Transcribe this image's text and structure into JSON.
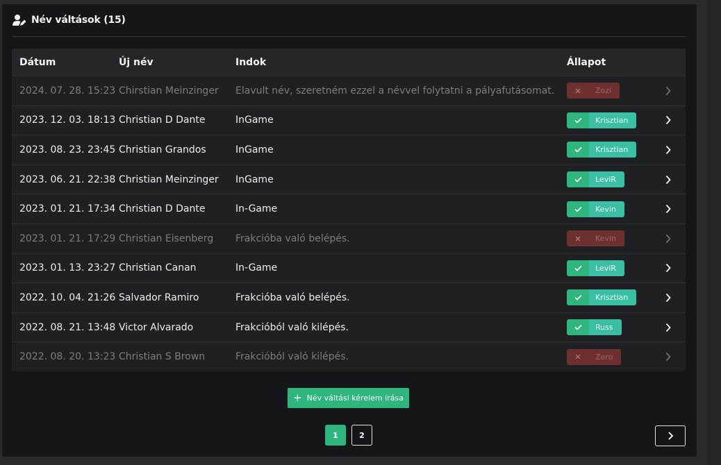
{
  "header": {
    "title": "Név váltások (15)",
    "icon": "user-edit-icon"
  },
  "table": {
    "columns": [
      "Dátum",
      "Új név",
      "Indok",
      "Állapot"
    ],
    "rows": [
      {
        "date": "2024. 07. 28. 15:23",
        "new_name": "Chirstian Meinzinger",
        "reason": "Elavult név, szeretném ezzel a névvel folytatni a pályafutásomat.",
        "status": "rejected",
        "handler": "Zozi"
      },
      {
        "date": "2023. 12. 03. 18:13",
        "new_name": "Christian D Dante",
        "reason": "InGame",
        "status": "approved",
        "handler": "Krisztian"
      },
      {
        "date": "2023. 08. 23. 23:45",
        "new_name": "Christian Grandos",
        "reason": "InGame",
        "status": "approved",
        "handler": "Krisztian"
      },
      {
        "date": "2023. 06. 21. 22:38",
        "new_name": "Christian Meinzinger",
        "reason": "InGame",
        "status": "approved",
        "handler": "LeviR"
      },
      {
        "date": "2023. 01. 21. 17:34",
        "new_name": "Christian D Dante",
        "reason": "In-Game",
        "status": "approved",
        "handler": "Kevin"
      },
      {
        "date": "2023. 01. 21. 17:29",
        "new_name": "Christian Eisenberg",
        "reason": "Frakcióba való belépés.",
        "status": "rejected",
        "handler": "Kevin"
      },
      {
        "date": "2023. 01. 13. 23:27",
        "new_name": "Christian Canan",
        "reason": "In-Game",
        "status": "approved",
        "handler": "LeviR"
      },
      {
        "date": "2022. 10. 04. 21:26",
        "new_name": "Salvador Ramiro",
        "reason": "Frakcióba való belépés.",
        "status": "approved",
        "handler": "Krisztian"
      },
      {
        "date": "2022. 08. 21. 13:48",
        "new_name": "Victor Alvarado",
        "reason": "Frakcióból való kilépés.",
        "status": "approved",
        "handler": "Russ"
      },
      {
        "date": "2022. 08. 20. 13:23",
        "new_name": "Christian S Brown",
        "reason": "Frakcióból való kilépés.",
        "status": "rejected",
        "handler": "Zero"
      }
    ]
  },
  "actions": {
    "add_label": "Név váltási kérelem írása"
  },
  "pagination": {
    "pages": [
      "1",
      "2"
    ],
    "current": "1"
  },
  "colors": {
    "approved": "#2fb57e",
    "approved_name": "#3bbfa2",
    "rejected": "#6e2f2f"
  }
}
